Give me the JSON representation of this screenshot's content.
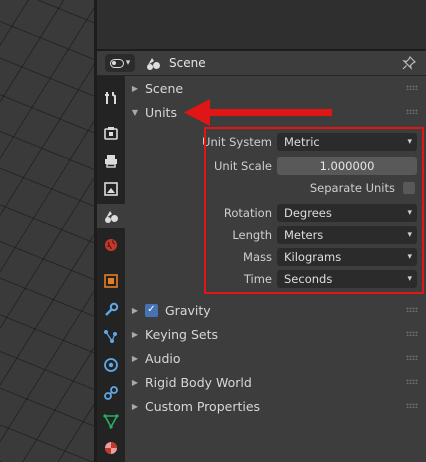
{
  "header": {
    "title": "Scene"
  },
  "panels": {
    "scene": "Scene",
    "units": "Units",
    "gravity": "Gravity",
    "keying_sets": "Keying Sets",
    "audio": "Audio",
    "rigid_body_world": "Rigid Body World",
    "custom_properties": "Custom Properties"
  },
  "units": {
    "unit_system": {
      "label": "Unit System",
      "value": "Metric"
    },
    "unit_scale": {
      "label": "Unit Scale",
      "value": "1.000000"
    },
    "separate_units": {
      "label": "Separate Units",
      "checked": false
    },
    "rotation": {
      "label": "Rotation",
      "value": "Degrees"
    },
    "length": {
      "label": "Length",
      "value": "Meters"
    },
    "mass": {
      "label": "Mass",
      "value": "Kilograms"
    },
    "time": {
      "label": "Time",
      "value": "Seconds"
    }
  },
  "gravity_enabled": true,
  "tabs": [
    "tool-icon",
    "render-icon",
    "output-icon",
    "view-layer-icon",
    "scene-icon",
    "world-icon",
    "object-icon",
    "modifier-icon",
    "particles-icon",
    "physics-icon",
    "constraints-icon",
    "data-icon",
    "material-icon"
  ],
  "colors": {
    "accent": "#4772b3",
    "highlight": "#e01515"
  }
}
